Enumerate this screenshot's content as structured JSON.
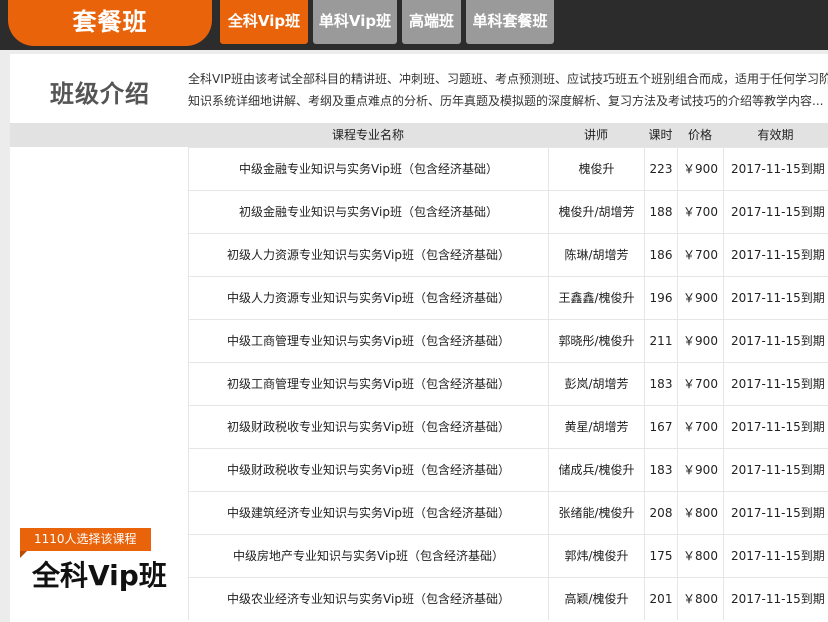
{
  "header": {
    "brand": "套餐班",
    "tabs": [
      {
        "label": "全科Vip班",
        "active": true
      },
      {
        "label": "单科Vip班",
        "active": false
      },
      {
        "label": "高端班",
        "active": false
      },
      {
        "label": "单科套餐班",
        "active": false
      }
    ]
  },
  "intro": {
    "title": "班级介绍",
    "line1": "全科VIP班由该考试全部科目的精讲班、冲刺班、习题班、考点预测班、应试技巧班五个班别组合而成，适用于任何学习阶",
    "line2": "知识系统详细地讲解、考纲及重点难点的分析、历年真题及模拟题的深度解析、复习方法及考试技巧的介绍等教学内容..."
  },
  "table": {
    "headers": [
      "课程专业名称",
      "讲师",
      "课时",
      "价格",
      "有效期"
    ],
    "rows": [
      {
        "name": "中级金融专业知识与实务Vip班（包含经济基础）",
        "teacher": "槐俊升",
        "hours": "223",
        "price": "￥900",
        "valid": "2017-11-15到期"
      },
      {
        "name": "初级金融专业知识与实务Vip班（包含经济基础）",
        "teacher": "槐俊升/胡增芳",
        "hours": "188",
        "price": "￥700",
        "valid": "2017-11-15到期"
      },
      {
        "name": "初级人力资源专业知识与实务Vip班（包含经济基础）",
        "teacher": "陈琳/胡增芳",
        "hours": "186",
        "price": "￥700",
        "valid": "2017-11-15到期"
      },
      {
        "name": "中级人力资源专业知识与实务Vip班（包含经济基础）",
        "teacher": "王鑫鑫/槐俊升",
        "hours": "196",
        "price": "￥900",
        "valid": "2017-11-15到期"
      },
      {
        "name": "中级工商管理专业知识与实务Vip班（包含经济基础）",
        "teacher": "郭晓彤/槐俊升",
        "hours": "211",
        "price": "￥900",
        "valid": "2017-11-15到期"
      },
      {
        "name": "初级工商管理专业知识与实务Vip班（包含经济基础）",
        "teacher": "彭岚/胡增芳",
        "hours": "183",
        "price": "￥700",
        "valid": "2017-11-15到期"
      },
      {
        "name": "初级财政税收专业知识与实务Vip班（包含经济基础）",
        "teacher": "黄星/胡增芳",
        "hours": "167",
        "price": "￥700",
        "valid": "2017-11-15到期"
      },
      {
        "name": "中级财政税收专业知识与实务Vip班（包含经济基础）",
        "teacher": "储成兵/槐俊升",
        "hours": "183",
        "price": "￥900",
        "valid": "2017-11-15到期"
      },
      {
        "name": "中级建筑经济专业知识与实务Vip班（包含经济基础）",
        "teacher": "张绪能/槐俊升",
        "hours": "208",
        "price": "￥800",
        "valid": "2017-11-15到期"
      },
      {
        "name": "中级房地产专业知识与实务Vip班（包含经济基础）",
        "teacher": "郭炜/槐俊升",
        "hours": "175",
        "price": "￥800",
        "valid": "2017-11-15到期"
      },
      {
        "name": "中级农业经济专业知识与实务Vip班（包含经济基础）",
        "teacher": "高颖/槐俊升",
        "hours": "201",
        "price": "￥800",
        "valid": "2017-11-15到期"
      }
    ]
  },
  "side": {
    "badge": "1110人选择该课程",
    "class_name": "全科Vip班"
  },
  "colors": {
    "accent": "#e8630a",
    "topbar": "#2c2c2c",
    "tab_inactive": "#9a9a9a"
  }
}
